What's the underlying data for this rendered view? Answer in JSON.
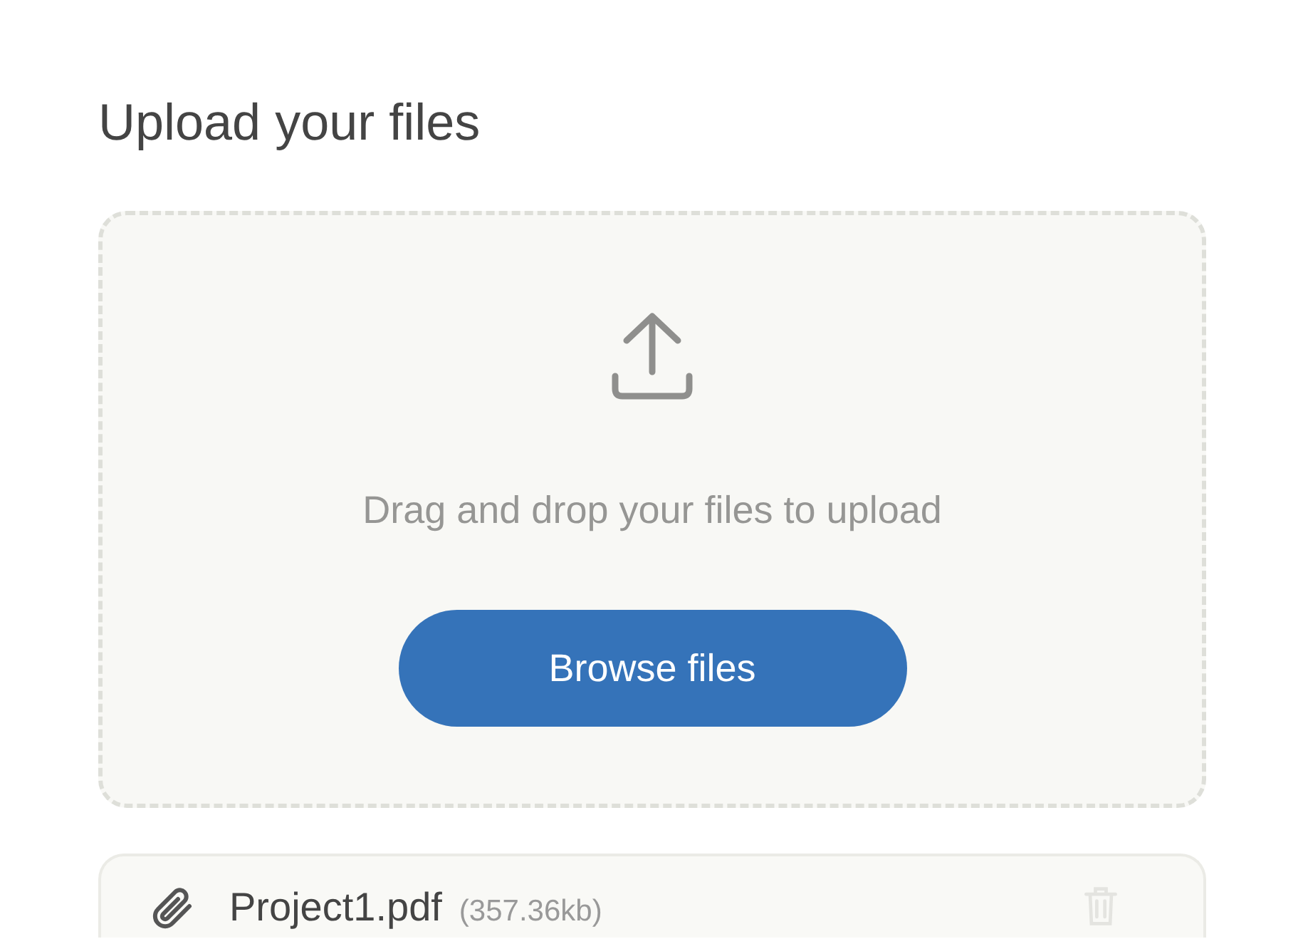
{
  "heading": "Upload your files",
  "dropzone": {
    "instruction": "Drag and drop your files to upload",
    "button": "Browse files"
  },
  "files": [
    {
      "name": "Project1.pdf",
      "size": "(357.36kb)"
    }
  ]
}
